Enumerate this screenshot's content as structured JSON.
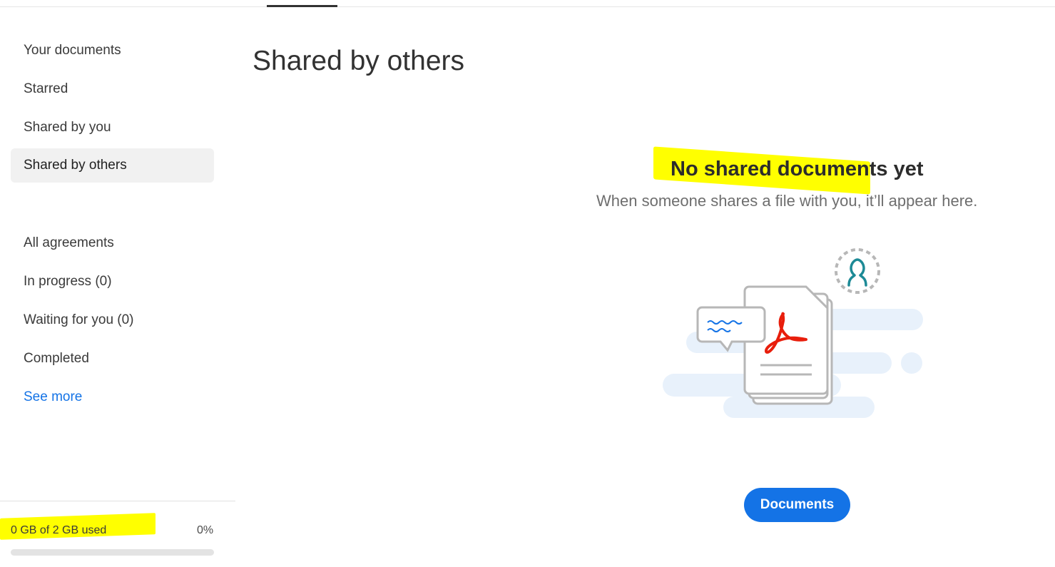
{
  "sidebar": {
    "documents_section": [
      {
        "label": "Your documents",
        "active": false
      },
      {
        "label": "Starred",
        "active": false
      },
      {
        "label": "Shared by you",
        "active": false
      },
      {
        "label": "Shared by others",
        "active": true
      }
    ],
    "agreements_section": [
      {
        "label": "All agreements"
      },
      {
        "label": "In progress (0)"
      },
      {
        "label": "Waiting for you (0)"
      },
      {
        "label": "Completed"
      }
    ],
    "see_more": "See more",
    "storage": {
      "used_text": "0 GB of 2 GB used",
      "percent_text": "0%",
      "used_fraction": 0
    }
  },
  "main": {
    "page_title": "Shared by others",
    "empty_state": {
      "title": "No shared documents yet",
      "subtitle": "When someone shares a file with you, it’ll appear here.",
      "illustration_icons": [
        "chat-bubble-icon",
        "pdf-document-stack-icon",
        "user-icon"
      ],
      "button_label": "Documents"
    }
  },
  "colors": {
    "accent": "#1473e6",
    "highlight": "#ffff00",
    "pdf_red": "#e81e0c",
    "user_teal": "#1d8a96"
  }
}
